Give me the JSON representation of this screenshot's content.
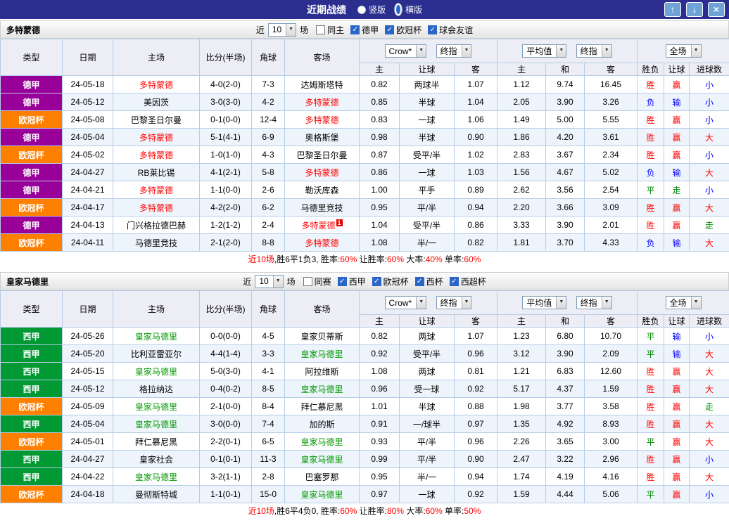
{
  "palette": {
    "red": "#ff0000",
    "blue": "#0000ff",
    "green": "#008800",
    "black": "#000000",
    "navy": "#2b2e8e"
  },
  "league_colors": {
    "德甲": "#990099",
    "欧冠杯": "#ff7f00",
    "西甲": "#009933"
  },
  "titlebar": {
    "title": "近期战绩",
    "view_options": [
      {
        "label": "竖版",
        "selected": false
      },
      {
        "label": "横版",
        "selected": true
      }
    ],
    "buttons": [
      {
        "name": "move-up",
        "glyph": "↑"
      },
      {
        "name": "move-down",
        "glyph": "↓"
      },
      {
        "name": "close",
        "glyph": "×"
      }
    ]
  },
  "labels": {
    "near": "近",
    "unit": "场"
  },
  "table": {
    "cols": [
      "类型",
      "日期",
      "主场",
      "比分(半场)",
      "角球",
      "客场"
    ],
    "sub": [
      "主",
      "让球",
      "客",
      "主",
      "和",
      "客",
      "胜负",
      "让球",
      "进球数"
    ],
    "odds1_source": "Crow*",
    "odds1_time": "终指",
    "odds2_source": "平均值",
    "odds2_time": "终指",
    "fullmatch": "全场"
  },
  "sections": [
    {
      "team": "多特蒙德",
      "team_color": "#ff0000",
      "near_count": "10",
      "checkboxes": [
        {
          "label": "同主",
          "checked": false
        },
        {
          "label": "德甲",
          "checked": true
        },
        {
          "label": "欧冠杯",
          "checked": true
        },
        {
          "label": "球会友谊",
          "checked": true
        }
      ],
      "rows": [
        {
          "lg": "德甲",
          "date": "24-05-18",
          "home": "多特蒙德",
          "hh": 1,
          "score": "4-0(2-0)",
          "cr": "7-3",
          "away": "达姆斯塔特",
          "ah": 0,
          "o1": [
            "0.82",
            "两球半",
            "1.07"
          ],
          "o2": [
            "1.12",
            "9.74",
            "16.45"
          ],
          "res": [
            [
              "胜",
              "red"
            ],
            [
              "赢",
              "red"
            ],
            [
              "小",
              "blue"
            ]
          ]
        },
        {
          "lg": "德甲",
          "date": "24-05-12",
          "home": "美因茨",
          "hh": 0,
          "score": "3-0(3-0)",
          "cr": "4-2",
          "away": "多特蒙德",
          "ah": 1,
          "o1": [
            "0.85",
            "半球",
            "1.04"
          ],
          "o2": [
            "2.05",
            "3.90",
            "3.26"
          ],
          "res": [
            [
              "负",
              "blue"
            ],
            [
              "输",
              "blue"
            ],
            [
              "小",
              "blue"
            ]
          ]
        },
        {
          "lg": "欧冠杯",
          "date": "24-05-08",
          "home": "巴黎圣日尔曼",
          "hh": 0,
          "score": "0-1(0-0)",
          "cr": "12-4",
          "away": "多特蒙德",
          "ah": 1,
          "o1": [
            "0.83",
            "一球",
            "1.06"
          ],
          "o2": [
            "1.49",
            "5.00",
            "5.55"
          ],
          "res": [
            [
              "胜",
              "red"
            ],
            [
              "赢",
              "red"
            ],
            [
              "小",
              "blue"
            ]
          ]
        },
        {
          "lg": "德甲",
          "date": "24-05-04",
          "home": "多特蒙德",
          "hh": 1,
          "score": "5-1(4-1)",
          "cr": "6-9",
          "away": "奥格斯堡",
          "ah": 0,
          "o1": [
            "0.98",
            "半球",
            "0.90"
          ],
          "o2": [
            "1.86",
            "4.20",
            "3.61"
          ],
          "res": [
            [
              "胜",
              "red"
            ],
            [
              "赢",
              "red"
            ],
            [
              "大",
              "red"
            ]
          ]
        },
        {
          "lg": "欧冠杯",
          "date": "24-05-02",
          "home": "多特蒙德",
          "hh": 1,
          "score": "1-0(1-0)",
          "cr": "4-3",
          "away": "巴黎圣日尔曼",
          "ah": 0,
          "o1": [
            "0.87",
            "受平/半",
            "1.02"
          ],
          "o2": [
            "2.83",
            "3.67",
            "2.34"
          ],
          "res": [
            [
              "胜",
              "red"
            ],
            [
              "赢",
              "red"
            ],
            [
              "小",
              "blue"
            ]
          ]
        },
        {
          "lg": "德甲",
          "date": "24-04-27",
          "home": "RB莱比锡",
          "hh": 0,
          "score": "4-1(2-1)",
          "cr": "5-8",
          "away": "多特蒙德",
          "ah": 1,
          "o1": [
            "0.86",
            "一球",
            "1.03"
          ],
          "o2": [
            "1.56",
            "4.67",
            "5.02"
          ],
          "res": [
            [
              "负",
              "blue"
            ],
            [
              "输",
              "blue"
            ],
            [
              "大",
              "red"
            ]
          ]
        },
        {
          "lg": "德甲",
          "date": "24-04-21",
          "home": "多特蒙德",
          "hh": 1,
          "score": "1-1(0-0)",
          "cr": "2-6",
          "away": "勒沃库森",
          "ah": 0,
          "o1": [
            "1.00",
            "平手",
            "0.89"
          ],
          "o2": [
            "2.62",
            "3.56",
            "2.54"
          ],
          "res": [
            [
              "平",
              "green"
            ],
            [
              "走",
              "green"
            ],
            [
              "小",
              "blue"
            ]
          ]
        },
        {
          "lg": "欧冠杯",
          "date": "24-04-17",
          "home": "多特蒙德",
          "hh": 1,
          "score": "4-2(2-0)",
          "cr": "6-2",
          "away": "马德里竞技",
          "ah": 0,
          "o1": [
            "0.95",
            "平/半",
            "0.94"
          ],
          "o2": [
            "2.20",
            "3.66",
            "3.09"
          ],
          "res": [
            [
              "胜",
              "red"
            ],
            [
              "赢",
              "red"
            ],
            [
              "大",
              "red"
            ]
          ]
        },
        {
          "lg": "德甲",
          "date": "24-04-13",
          "home": "门兴格拉德巴赫",
          "hh": 0,
          "score": "1-2(1-2)",
          "cr": "2-4",
          "away": "多特蒙德",
          "ah": 1,
          "asup": "1",
          "o1": [
            "1.04",
            "受平/半",
            "0.86"
          ],
          "o2": [
            "3.33",
            "3.90",
            "2.01"
          ],
          "res": [
            [
              "胜",
              "red"
            ],
            [
              "赢",
              "red"
            ],
            [
              "走",
              "green"
            ]
          ]
        },
        {
          "lg": "欧冠杯",
          "date": "24-04-11",
          "home": "马德里竞技",
          "hh": 0,
          "score": "2-1(2-0)",
          "cr": "8-8",
          "away": "多特蒙德",
          "ah": 1,
          "o1": [
            "1.08",
            "半/一",
            "0.82"
          ],
          "o2": [
            "1.81",
            "3.70",
            "4.33"
          ],
          "res": [
            [
              "负",
              "blue"
            ],
            [
              "输",
              "blue"
            ],
            [
              "大",
              "red"
            ]
          ]
        }
      ],
      "summary": [
        [
          "近10场",
          "red"
        ],
        [
          ",胜6平1负3, 胜率:",
          "black"
        ],
        [
          "60%",
          "red"
        ],
        [
          " 让胜率:",
          "black"
        ],
        [
          "60%",
          "red"
        ],
        [
          " 大率:",
          "black"
        ],
        [
          "40%",
          "red"
        ],
        [
          " 单率:",
          "black"
        ],
        [
          "60%",
          "red"
        ]
      ]
    },
    {
      "team": "皇家马德里",
      "team_color": "#009900",
      "near_count": "10",
      "checkboxes": [
        {
          "label": "同赛",
          "checked": false
        },
        {
          "label": "西甲",
          "checked": true
        },
        {
          "label": "欧冠杯",
          "checked": true
        },
        {
          "label": "西杯",
          "checked": true
        },
        {
          "label": "西超杯",
          "checked": true
        }
      ],
      "rows": [
        {
          "lg": "西甲",
          "date": "24-05-26",
          "home": "皇家马德里",
          "hh": 1,
          "score": "0-0(0-0)",
          "cr": "4-5",
          "away": "皇家贝蒂斯",
          "ah": 0,
          "o1": [
            "0.82",
            "两球",
            "1.07"
          ],
          "o2": [
            "1.23",
            "6.80",
            "10.70"
          ],
          "res": [
            [
              "平",
              "green"
            ],
            [
              "输",
              "blue"
            ],
            [
              "小",
              "blue"
            ]
          ]
        },
        {
          "lg": "西甲",
          "date": "24-05-20",
          "home": "比利亚雷亚尔",
          "hh": 0,
          "score": "4-4(1-4)",
          "cr": "3-3",
          "away": "皇家马德里",
          "ah": 1,
          "o1": [
            "0.92",
            "受平/半",
            "0.96"
          ],
          "o2": [
            "3.12",
            "3.90",
            "2.09"
          ],
          "res": [
            [
              "平",
              "green"
            ],
            [
              "输",
              "blue"
            ],
            [
              "大",
              "red"
            ]
          ]
        },
        {
          "lg": "西甲",
          "date": "24-05-15",
          "home": "皇家马德里",
          "hh": 1,
          "score": "5-0(3-0)",
          "cr": "4-1",
          "away": "阿拉维斯",
          "ah": 0,
          "o1": [
            "1.08",
            "两球",
            "0.81"
          ],
          "o2": [
            "1.21",
            "6.83",
            "12.60"
          ],
          "res": [
            [
              "胜",
              "red"
            ],
            [
              "赢",
              "red"
            ],
            [
              "大",
              "red"
            ]
          ]
        },
        {
          "lg": "西甲",
          "date": "24-05-12",
          "home": "格拉纳达",
          "hh": 0,
          "score": "0-4(0-2)",
          "cr": "8-5",
          "away": "皇家马德里",
          "ah": 1,
          "o1": [
            "0.96",
            "受一球",
            "0.92"
          ],
          "o2": [
            "5.17",
            "4.37",
            "1.59"
          ],
          "res": [
            [
              "胜",
              "red"
            ],
            [
              "赢",
              "red"
            ],
            [
              "大",
              "red"
            ]
          ]
        },
        {
          "lg": "欧冠杯",
          "date": "24-05-09",
          "home": "皇家马德里",
          "hh": 1,
          "score": "2-1(0-0)",
          "cr": "8-4",
          "away": "拜仁慕尼黑",
          "ah": 0,
          "o1": [
            "1.01",
            "半球",
            "0.88"
          ],
          "o2": [
            "1.98",
            "3.77",
            "3.58"
          ],
          "res": [
            [
              "胜",
              "red"
            ],
            [
              "赢",
              "red"
            ],
            [
              "走",
              "green"
            ]
          ]
        },
        {
          "lg": "西甲",
          "date": "24-05-04",
          "home": "皇家马德里",
          "hh": 1,
          "score": "3-0(0-0)",
          "cr": "7-4",
          "away": "加的斯",
          "ah": 0,
          "o1": [
            "0.91",
            "一/球半",
            "0.97"
          ],
          "o2": [
            "1.35",
            "4.92",
            "8.93"
          ],
          "res": [
            [
              "胜",
              "red"
            ],
            [
              "赢",
              "red"
            ],
            [
              "大",
              "red"
            ]
          ]
        },
        {
          "lg": "欧冠杯",
          "date": "24-05-01",
          "home": "拜仁慕尼黑",
          "hh": 0,
          "score": "2-2(0-1)",
          "cr": "6-5",
          "away": "皇家马德里",
          "ah": 1,
          "o1": [
            "0.93",
            "平/半",
            "0.96"
          ],
          "o2": [
            "2.26",
            "3.65",
            "3.00"
          ],
          "res": [
            [
              "平",
              "green"
            ],
            [
              "赢",
              "red"
            ],
            [
              "大",
              "red"
            ]
          ]
        },
        {
          "lg": "西甲",
          "date": "24-04-27",
          "home": "皇家社会",
          "hh": 0,
          "score": "0-1(0-1)",
          "cr": "11-3",
          "away": "皇家马德里",
          "ah": 1,
          "o1": [
            "0.99",
            "平/半",
            "0.90"
          ],
          "o2": [
            "2.47",
            "3.22",
            "2.96"
          ],
          "res": [
            [
              "胜",
              "red"
            ],
            [
              "赢",
              "red"
            ],
            [
              "小",
              "blue"
            ]
          ]
        },
        {
          "lg": "西甲",
          "date": "24-04-22",
          "home": "皇家马德里",
          "hh": 1,
          "score": "3-2(1-1)",
          "cr": "2-8",
          "away": "巴塞罗那",
          "ah": 0,
          "o1": [
            "0.95",
            "半/一",
            "0.94"
          ],
          "o2": [
            "1.74",
            "4.19",
            "4.16"
          ],
          "res": [
            [
              "胜",
              "red"
            ],
            [
              "赢",
              "red"
            ],
            [
              "大",
              "red"
            ]
          ]
        },
        {
          "lg": "欧冠杯",
          "date": "24-04-18",
          "home": "曼彻斯特城",
          "hh": 0,
          "score": "1-1(0-1)",
          "cr": "15-0",
          "away": "皇家马德里",
          "ah": 1,
          "o1": [
            "0.97",
            "一球",
            "0.92"
          ],
          "o2": [
            "1.59",
            "4.44",
            "5.06"
          ],
          "res": [
            [
              "平",
              "green"
            ],
            [
              "赢",
              "red"
            ],
            [
              "小",
              "blue"
            ]
          ]
        }
      ],
      "summary": [
        [
          "近10场",
          "red"
        ],
        [
          ",胜6平4负0, 胜率:",
          "black"
        ],
        [
          "60%",
          "red"
        ],
        [
          " 让胜率:",
          "black"
        ],
        [
          "80%",
          "red"
        ],
        [
          " 大率:",
          "black"
        ],
        [
          "60%",
          "red"
        ],
        [
          " 单率:",
          "black"
        ],
        [
          "50%",
          "red"
        ]
      ]
    }
  ]
}
